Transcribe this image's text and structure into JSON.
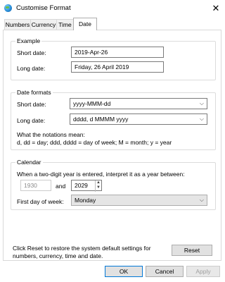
{
  "window": {
    "title": "Customise Format",
    "close_glyph": "✕"
  },
  "tabs": [
    {
      "label": "Numbers",
      "active": false
    },
    {
      "label": "Currency",
      "active": false
    },
    {
      "label": "Time",
      "active": false
    },
    {
      "label": "Date",
      "active": true
    }
  ],
  "example": {
    "group_label": "Example",
    "short_label": "Short date:",
    "short_value": "2019-Apr-26",
    "long_label": "Long date:",
    "long_value": "Friday, 26 April 2019"
  },
  "formats": {
    "group_label": "Date formats",
    "short_label": "Short date:",
    "short_value": "yyyy-MMM-dd",
    "long_label": "Long date:",
    "long_value": "dddd, d MMMM yyyy",
    "notations_heading": "What the notations mean:",
    "notations_text": "d, dd = day;  ddd, dddd = day of week;  M = month;  y = year"
  },
  "calendar": {
    "group_label": "Calendar",
    "twodigit_text": "When a two-digit year is entered, interpret it as a year between:",
    "from_year": "1930",
    "and_label": "and",
    "to_year": "2029",
    "first_day_label": "First day of week:",
    "first_day_value": "Monday"
  },
  "reset": {
    "text_line1": "Click Reset to restore the system default settings for",
    "text_line2": "numbers, currency, time and date.",
    "button_label": "Reset"
  },
  "footer": {
    "ok_label": "OK",
    "cancel_label": "Cancel",
    "apply_label": "Apply"
  },
  "icons": {
    "dropdown": "⌵",
    "spin_up": "▲",
    "spin_down": "▼"
  },
  "colors": {
    "ok_border": "#0078d7",
    "panel_border": "#d9d9d9"
  }
}
